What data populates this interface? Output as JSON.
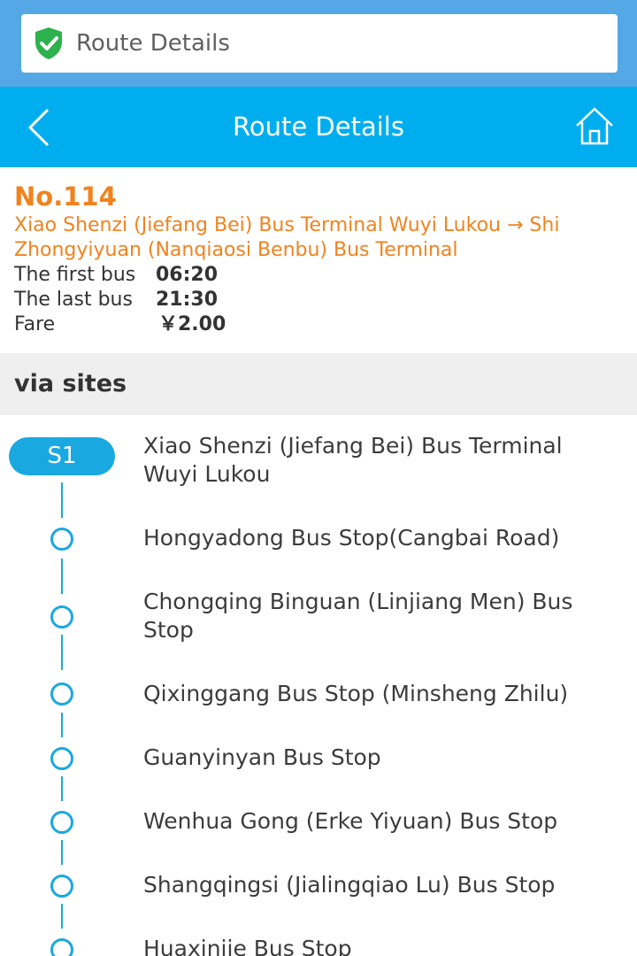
{
  "browser": {
    "address_title": "Route Details",
    "shield_icon": "shield-check-icon",
    "shield_color": "#2bb24c"
  },
  "header": {
    "title": "Route Details",
    "back_icon": "chevron-left-icon",
    "home_icon": "home-icon",
    "background": "#00aeef"
  },
  "route": {
    "number": "No.114",
    "path": "Xiao Shenzi (Jiefang Bei) Bus Terminal Wuyi Lukou → Shi Zhongyiyuan (Nanqiaosi Benbu) Bus Terminal",
    "first_bus_label": "The first bus",
    "first_bus_time": "06:20",
    "last_bus_label": "The last bus",
    "last_bus_time": "21:30",
    "fare_label": "Fare",
    "fare_value": "￥2.00",
    "accent": "#f0831e"
  },
  "via": {
    "title": "via sites",
    "start_badge": "S1",
    "stops": [
      "Xiao Shenzi (Jiefang Bei) Bus Terminal Wuyi Lukou",
      "Hongyadong Bus Stop(Cangbai Road)",
      "Chongqing Binguan (Linjiang Men) Bus Stop",
      "Qixinggang Bus Stop (Minsheng Zhilu)",
      "Guanyinyan Bus Stop",
      "Wenhua Gong (Erke Yiyuan) Bus Stop",
      "Shangqingsi (Jialingqiao Lu) Bus Stop",
      "Huaxinjie Bus Stop"
    ]
  }
}
